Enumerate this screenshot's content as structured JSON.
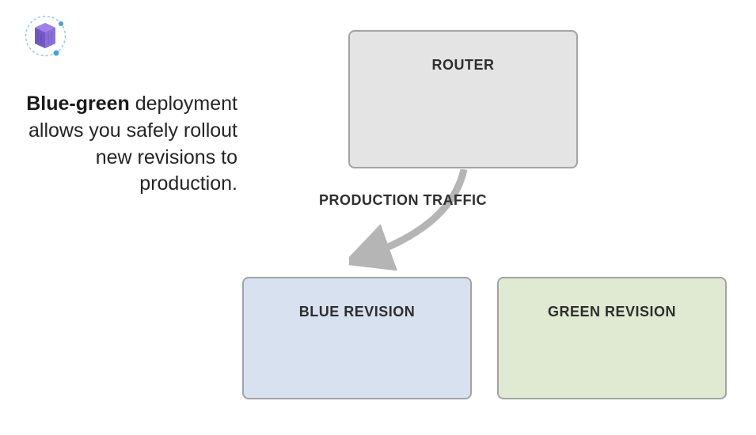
{
  "description": {
    "bold_term": "Blue-green",
    "text": " deployment allows you safely rollout new revisions to production."
  },
  "boxes": {
    "router": "ROUTER",
    "blue": "BLUE REVISION",
    "green": "GREEN REVISION"
  },
  "arrow_label": "PRODUCTION TRAFFIC",
  "colors": {
    "router_bg": "#e4e4e4",
    "blue_bg": "#d8e1f0",
    "green_bg": "#e0ead3",
    "border": "#a3a3a3",
    "arrow": "#b5b5b5"
  }
}
